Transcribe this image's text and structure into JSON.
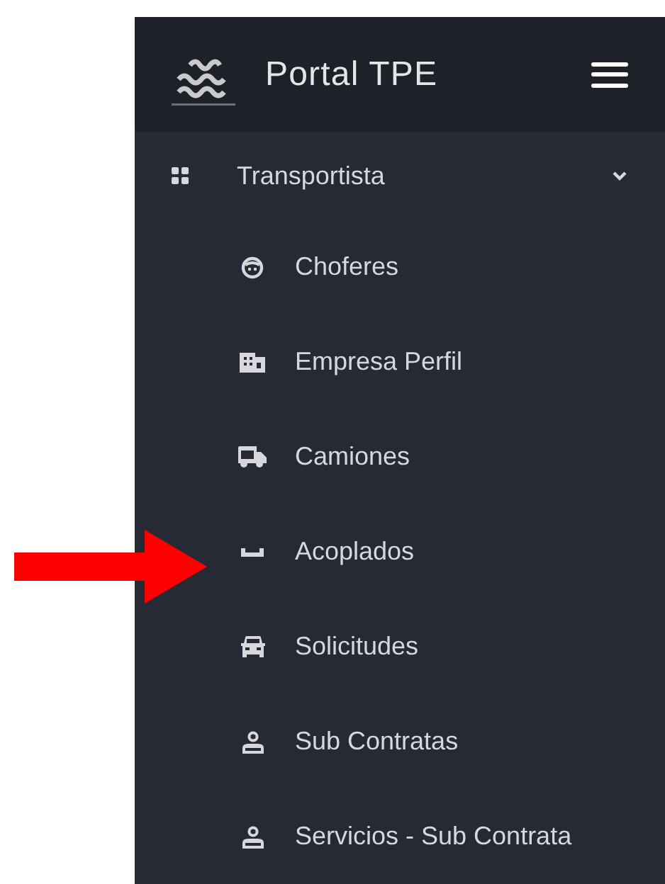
{
  "header": {
    "title": "Portal TPE"
  },
  "menu": {
    "label": "Transportista",
    "expanded": true,
    "children": [
      {
        "label": "Choferes",
        "kind": "face"
      },
      {
        "label": "Empresa Perfil",
        "kind": "building"
      },
      {
        "label": "Camiones",
        "kind": "truck"
      },
      {
        "label": "Acoplados",
        "kind": "trailer"
      },
      {
        "label": "Solicitudes",
        "kind": "car"
      },
      {
        "label": "Sub Contratas",
        "kind": "user"
      },
      {
        "label": "Servicios - Sub Contrata",
        "kind": "user"
      }
    ]
  }
}
